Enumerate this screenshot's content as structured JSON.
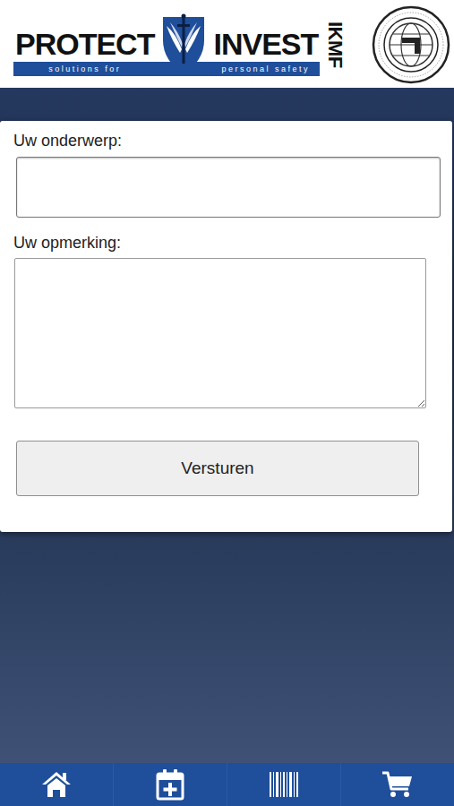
{
  "header": {
    "brand_left": "PROTECT",
    "brand_right": "INVEST",
    "tagline_left": "solutions for",
    "tagline_right": "personal safety",
    "side_label": "IKMF"
  },
  "form": {
    "fields": [
      {
        "label": "Uw onderwerp:",
        "kind": "input",
        "value": ""
      },
      {
        "label": "Uw opmerking:",
        "kind": "textarea",
        "value": ""
      }
    ],
    "submit": "Versturen"
  },
  "bottom_nav": {
    "items": [
      {
        "kind": "home"
      },
      {
        "kind": "calendar"
      },
      {
        "kind": "barcode"
      },
      {
        "kind": "cart"
      }
    ]
  }
}
